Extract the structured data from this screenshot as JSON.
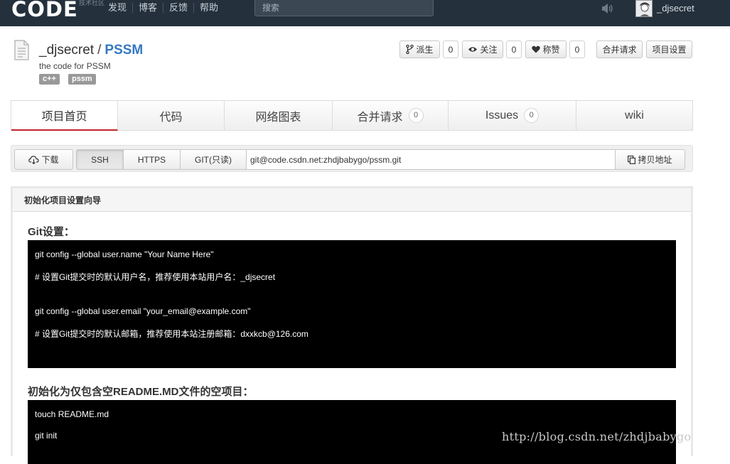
{
  "topbar": {
    "logo": "CODE",
    "logo_sub": "技术社区",
    "nav": [
      "发现",
      "博客",
      "反馈",
      "帮助"
    ],
    "search_placeholder": "搜索",
    "username": "_djsecret",
    "icons": [
      "speaker-icon",
      "avatar"
    ]
  },
  "repo": {
    "owner": "_djsecret",
    "separator": "/",
    "name": "PSSM",
    "description": "the code for PSSM",
    "tags": [
      "c++",
      "pssm"
    ]
  },
  "actions": {
    "fork_label": "派生",
    "fork_count": "0",
    "watch_label": "关注",
    "watch_count": "0",
    "star_label": "称赞",
    "star_count": "0",
    "merge_request_label": "合并请求",
    "settings_label": "项目设置"
  },
  "tabs": [
    {
      "label": "项目首页",
      "active": true
    },
    {
      "label": "代码"
    },
    {
      "label": "网络图表"
    },
    {
      "label": "合并请求",
      "badge": "0"
    },
    {
      "label": "Issues",
      "badge": "0"
    },
    {
      "label": "wiki"
    }
  ],
  "clone": {
    "download_label": "下载",
    "protocols": [
      "SSH",
      "HTTPS",
      "GIT(只读)"
    ],
    "selected_protocol": "SSH",
    "url": "git@code.csdn.net:zhdjbabygo/pssm.git",
    "copy_label": "拷贝地址"
  },
  "setup": {
    "header": "初始化项目设置向导",
    "git_title": "Git设置：",
    "git_lines": [
      "git config --global user.name \"Your Name Here\"",
      "# 设置Git提交时的默认用户名，推荐使用本站用户名：_djsecret",
      "git config --global user.email \"your_email@example.com\"",
      "# 设置Git提交时的默认邮箱，推荐使用本站注册邮箱：dxxkcb@126.com"
    ],
    "init_title": "初始化为仅包含空README.MD文件的空项目：",
    "init_lines": [
      "touch README.md",
      "git init"
    ]
  },
  "watermark": "http://blog.csdn.net/zhdjbabygo",
  "colors": {
    "topbar": "#24303c",
    "accent_link": "#3478c2",
    "active_tab_underline": "#c0242a",
    "code_bg": "#000000"
  }
}
